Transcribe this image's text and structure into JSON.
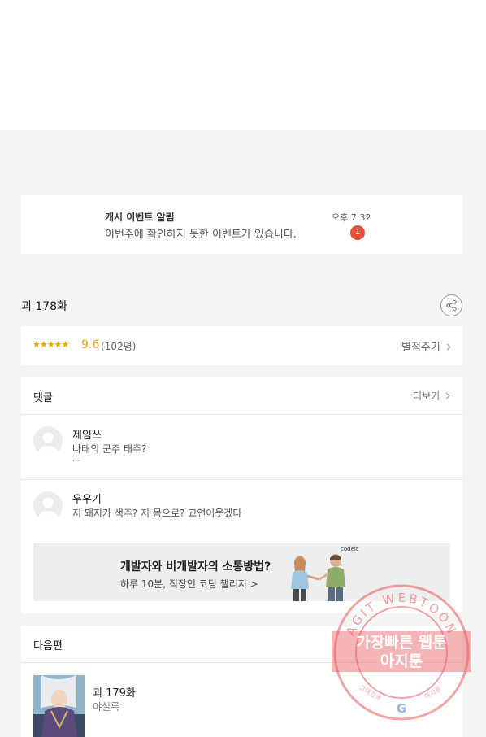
{
  "notice": {
    "title": "캐시 이벤트 알림",
    "body": "이번주에 확인하지 못한 이벤트가 있습니다.",
    "time": "오후 7:32",
    "badge": "1"
  },
  "episode": {
    "title": "괴 178화",
    "share_icon": "share-icon"
  },
  "rating": {
    "stars": "★★★★★",
    "score": "9.6",
    "count": "(102명)",
    "rate_link": "별점주기"
  },
  "comments": {
    "header": "댓글",
    "more": "더보기",
    "items": [
      {
        "name": "제임쓰",
        "text": "나태의 군주 태주?",
        "more": "..."
      },
      {
        "name": "우우기",
        "text": "저 돼지가 색주? 저 몸으로? 교연이웃겠다"
      }
    ]
  },
  "ad": {
    "headline": "개발자와 비개발자의 소통방법?",
    "sub": "하루 10분, 직장인 코딩 챌리지 >",
    "brand": "codeit"
  },
  "next": {
    "header": "다음편",
    "title": "괴 179화",
    "subtitle": "야설록"
  },
  "watermark": {
    "ring_text": "AGIT WEBTOON",
    "line1": "가장빠른 웹툰",
    "line2": "아지툰",
    "bottom_left": "그대검색",
    "bottom_right": "아지툰",
    "logo": "G"
  },
  "colors": {
    "accent": "#f0a30a",
    "badge": "#e5533d",
    "stamp": "#e8595c"
  }
}
